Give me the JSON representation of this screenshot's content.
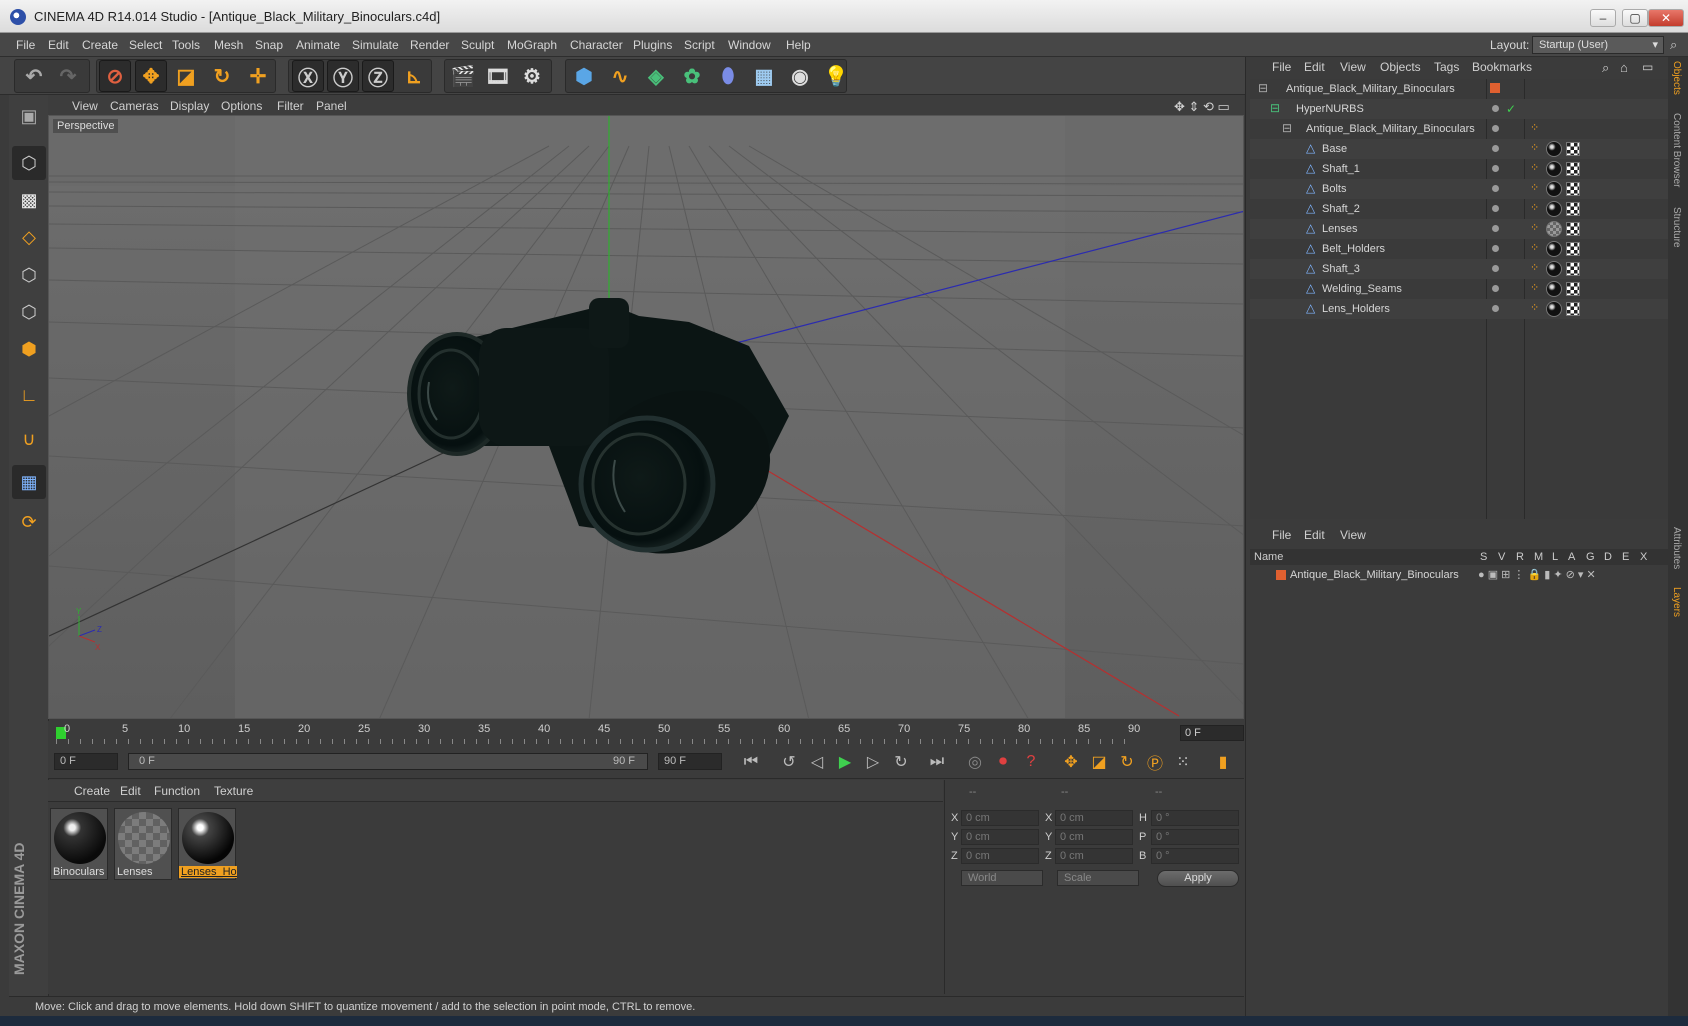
{
  "window": {
    "title": "CINEMA 4D R14.014 Studio - [Antique_Black_Military_Binoculars.c4d]",
    "min": "–",
    "max": "▢",
    "close": "✕"
  },
  "menubar": {
    "items": [
      "File",
      "Edit",
      "Create",
      "Select",
      "Tools",
      "Mesh",
      "Snap",
      "Animate",
      "Simulate",
      "Render",
      "Sculpt",
      "MoGraph",
      "Character",
      "Plugins",
      "Script",
      "Window",
      "Help"
    ],
    "layout_label": "Layout:",
    "layout_value": "Startup (User)"
  },
  "viewport": {
    "menu": [
      "View",
      "Cameras",
      "Display",
      "Options",
      "Filter",
      "Panel"
    ],
    "camera_label": "Perspective"
  },
  "timeline": {
    "ticks": [
      "0",
      "5",
      "10",
      "15",
      "20",
      "25",
      "30",
      "35",
      "40",
      "45",
      "50",
      "55",
      "60",
      "65",
      "70",
      "75",
      "80",
      "85",
      "90"
    ],
    "current_frame": "0 F",
    "start_field": "0 F",
    "range_start": "0 F",
    "range_end": "90 F",
    "end_field": "90 F"
  },
  "material_manager": {
    "menu": [
      "Create",
      "Edit",
      "Function",
      "Texture"
    ],
    "materials": [
      {
        "name": "Binoculars"
      },
      {
        "name": "Lenses"
      },
      {
        "name": "Lenses_Hol"
      }
    ]
  },
  "coordinates": {
    "headers": [
      "--",
      "--",
      "--"
    ],
    "rows": [
      {
        "l1": "X",
        "v1": "0 cm",
        "l2": "X",
        "v2": "0 cm",
        "l3": "H",
        "v3": "0 °"
      },
      {
        "l1": "Y",
        "v1": "0 cm",
        "l2": "Y",
        "v2": "0 cm",
        "l3": "P",
        "v3": "0 °"
      },
      {
        "l1": "Z",
        "v1": "0 cm",
        "l2": "Z",
        "v2": "0 cm",
        "l3": "B",
        "v3": "0 °"
      }
    ],
    "mode1": "World",
    "mode2": "Scale",
    "apply": "Apply"
  },
  "status": "Move: Click and drag to move elements. Hold down SHIFT to quantize movement / add to the selection in point mode, CTRL to remove.",
  "object_manager": {
    "menu": [
      "File",
      "Edit",
      "View",
      "Objects",
      "Tags",
      "Bookmarks"
    ],
    "objects": [
      {
        "name": "Antique_Black_Military_Binoculars"
      },
      {
        "name": "HyperNURBS"
      },
      {
        "name": "Antique_Black_Military_Binoculars"
      },
      {
        "name": "Base"
      },
      {
        "name": "Shaft_1"
      },
      {
        "name": "Bolts"
      },
      {
        "name": "Shaft_2"
      },
      {
        "name": "Lenses"
      },
      {
        "name": "Belt_Holders"
      },
      {
        "name": "Shaft_3"
      },
      {
        "name": "Welding_Seams"
      },
      {
        "name": "Lens_Holders"
      }
    ]
  },
  "layer_manager": {
    "menu": [
      "File",
      "Edit",
      "View"
    ],
    "columns": [
      "Name",
      "S",
      "V",
      "R",
      "M",
      "L",
      "A",
      "G",
      "D",
      "E",
      "X"
    ],
    "layer_name": "Antique_Black_Military_Binoculars"
  },
  "right_tabs": [
    "Objects",
    "Content Browser",
    "Structure",
    "Attributes",
    "Layers"
  ],
  "branding": "MAXON CINEMA 4D",
  "colors": {
    "accent": "#f0a020",
    "background": "#3b3b3b"
  }
}
